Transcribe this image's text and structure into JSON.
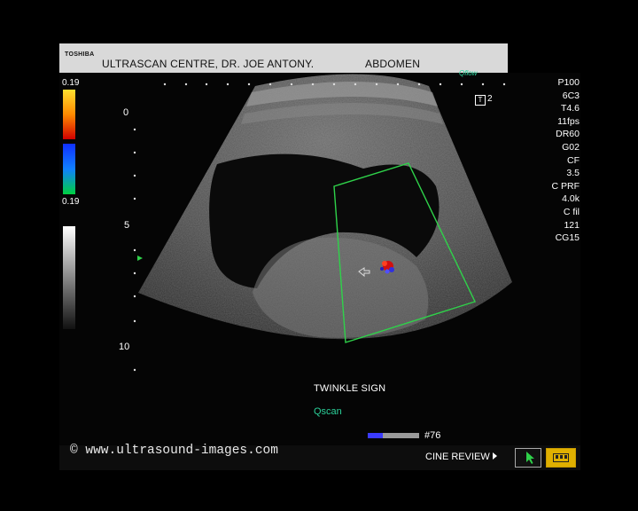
{
  "header": {
    "brand": "TOSHIBA",
    "title": "ULTRASCAN CENTRE, DR. JOE ANTONY.",
    "exam": "ABDOMEN",
    "qflow": "Qflow"
  },
  "color_scale": {
    "top_value": "0.19",
    "bottom_value": "0.19"
  },
  "depth_markers": [
    "0",
    "5",
    "10"
  ],
  "transducer_indicator": "2",
  "parameters": [
    "P100",
    "6C3",
    "T4.6",
    "11fps",
    "DR60",
    "G02",
    "CF",
    "3.5",
    "C PRF",
    "4.0k",
    "C fil",
    "121",
    "CG15"
  ],
  "caption": "TWINKLE SIGN",
  "qscan": "Qscan",
  "cine": {
    "frame_number": "#76",
    "frame_fraction": 0.3,
    "review_label": "CINE REVIEW"
  },
  "copyright": "© www.ultrasound-images.com",
  "colors": {
    "header_bg": "#d9d9d9",
    "roi_box": "#2fd24a",
    "qscan_text": "#2bd19a",
    "cine_button": "#e0b000"
  }
}
